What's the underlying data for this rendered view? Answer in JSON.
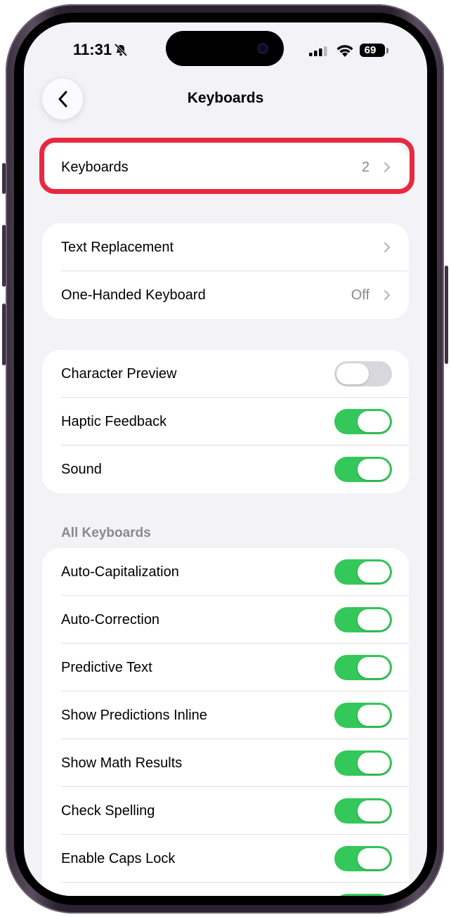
{
  "status_bar": {
    "time": "11:31",
    "battery": "69"
  },
  "nav": {
    "title": "Keyboards"
  },
  "group1": [
    {
      "label": "Keyboards",
      "value": "2"
    }
  ],
  "group2": [
    {
      "label": "Text Replacement",
      "value": ""
    },
    {
      "label": "One-Handed Keyboard",
      "value": "Off"
    }
  ],
  "group3": [
    {
      "label": "Character Preview",
      "toggle": false
    },
    {
      "label": "Haptic Feedback",
      "toggle": true
    },
    {
      "label": "Sound",
      "toggle": true
    }
  ],
  "all_keyboards": {
    "header": "All Keyboards",
    "rows": [
      {
        "label": "Auto-Capitalization",
        "toggle": true
      },
      {
        "label": "Auto-Correction",
        "toggle": true
      },
      {
        "label": "Predictive Text",
        "toggle": true
      },
      {
        "label": "Show Predictions Inline",
        "toggle": true
      },
      {
        "label": "Show Math Results",
        "toggle": true
      },
      {
        "label": "Check Spelling",
        "toggle": true
      },
      {
        "label": "Enable Caps Lock",
        "toggle": true
      }
    ]
  },
  "colors": {
    "accent_green": "#34c759",
    "highlight_red": "#e8283f"
  },
  "icons": [
    "back-chevron-icon",
    "silent-bell-icon",
    "cellular-signal-icon",
    "wifi-icon",
    "battery-icon",
    "chevron-right-icon"
  ]
}
